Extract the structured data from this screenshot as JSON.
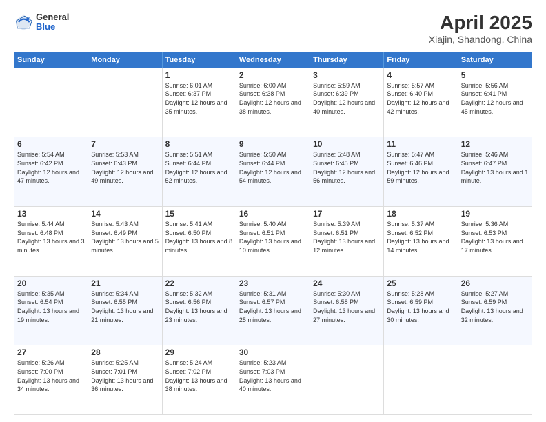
{
  "header": {
    "logo_line1": "General",
    "logo_line2": "Blue",
    "title": "April 2025",
    "subtitle": "Xiajin, Shandong, China"
  },
  "days_of_week": [
    "Sunday",
    "Monday",
    "Tuesday",
    "Wednesday",
    "Thursday",
    "Friday",
    "Saturday"
  ],
  "weeks": [
    [
      {
        "day": "",
        "sunrise": "",
        "sunset": "",
        "daylight": ""
      },
      {
        "day": "",
        "sunrise": "",
        "sunset": "",
        "daylight": ""
      },
      {
        "day": "1",
        "sunrise": "Sunrise: 6:01 AM",
        "sunset": "Sunset: 6:37 PM",
        "daylight": "Daylight: 12 hours and 35 minutes."
      },
      {
        "day": "2",
        "sunrise": "Sunrise: 6:00 AM",
        "sunset": "Sunset: 6:38 PM",
        "daylight": "Daylight: 12 hours and 38 minutes."
      },
      {
        "day": "3",
        "sunrise": "Sunrise: 5:59 AM",
        "sunset": "Sunset: 6:39 PM",
        "daylight": "Daylight: 12 hours and 40 minutes."
      },
      {
        "day": "4",
        "sunrise": "Sunrise: 5:57 AM",
        "sunset": "Sunset: 6:40 PM",
        "daylight": "Daylight: 12 hours and 42 minutes."
      },
      {
        "day": "5",
        "sunrise": "Sunrise: 5:56 AM",
        "sunset": "Sunset: 6:41 PM",
        "daylight": "Daylight: 12 hours and 45 minutes."
      }
    ],
    [
      {
        "day": "6",
        "sunrise": "Sunrise: 5:54 AM",
        "sunset": "Sunset: 6:42 PM",
        "daylight": "Daylight: 12 hours and 47 minutes."
      },
      {
        "day": "7",
        "sunrise": "Sunrise: 5:53 AM",
        "sunset": "Sunset: 6:43 PM",
        "daylight": "Daylight: 12 hours and 49 minutes."
      },
      {
        "day": "8",
        "sunrise": "Sunrise: 5:51 AM",
        "sunset": "Sunset: 6:44 PM",
        "daylight": "Daylight: 12 hours and 52 minutes."
      },
      {
        "day": "9",
        "sunrise": "Sunrise: 5:50 AM",
        "sunset": "Sunset: 6:44 PM",
        "daylight": "Daylight: 12 hours and 54 minutes."
      },
      {
        "day": "10",
        "sunrise": "Sunrise: 5:48 AM",
        "sunset": "Sunset: 6:45 PM",
        "daylight": "Daylight: 12 hours and 56 minutes."
      },
      {
        "day": "11",
        "sunrise": "Sunrise: 5:47 AM",
        "sunset": "Sunset: 6:46 PM",
        "daylight": "Daylight: 12 hours and 59 minutes."
      },
      {
        "day": "12",
        "sunrise": "Sunrise: 5:46 AM",
        "sunset": "Sunset: 6:47 PM",
        "daylight": "Daylight: 13 hours and 1 minute."
      }
    ],
    [
      {
        "day": "13",
        "sunrise": "Sunrise: 5:44 AM",
        "sunset": "Sunset: 6:48 PM",
        "daylight": "Daylight: 13 hours and 3 minutes."
      },
      {
        "day": "14",
        "sunrise": "Sunrise: 5:43 AM",
        "sunset": "Sunset: 6:49 PM",
        "daylight": "Daylight: 13 hours and 5 minutes."
      },
      {
        "day": "15",
        "sunrise": "Sunrise: 5:41 AM",
        "sunset": "Sunset: 6:50 PM",
        "daylight": "Daylight: 13 hours and 8 minutes."
      },
      {
        "day": "16",
        "sunrise": "Sunrise: 5:40 AM",
        "sunset": "Sunset: 6:51 PM",
        "daylight": "Daylight: 13 hours and 10 minutes."
      },
      {
        "day": "17",
        "sunrise": "Sunrise: 5:39 AM",
        "sunset": "Sunset: 6:51 PM",
        "daylight": "Daylight: 13 hours and 12 minutes."
      },
      {
        "day": "18",
        "sunrise": "Sunrise: 5:37 AM",
        "sunset": "Sunset: 6:52 PM",
        "daylight": "Daylight: 13 hours and 14 minutes."
      },
      {
        "day": "19",
        "sunrise": "Sunrise: 5:36 AM",
        "sunset": "Sunset: 6:53 PM",
        "daylight": "Daylight: 13 hours and 17 minutes."
      }
    ],
    [
      {
        "day": "20",
        "sunrise": "Sunrise: 5:35 AM",
        "sunset": "Sunset: 6:54 PM",
        "daylight": "Daylight: 13 hours and 19 minutes."
      },
      {
        "day": "21",
        "sunrise": "Sunrise: 5:34 AM",
        "sunset": "Sunset: 6:55 PM",
        "daylight": "Daylight: 13 hours and 21 minutes."
      },
      {
        "day": "22",
        "sunrise": "Sunrise: 5:32 AM",
        "sunset": "Sunset: 6:56 PM",
        "daylight": "Daylight: 13 hours and 23 minutes."
      },
      {
        "day": "23",
        "sunrise": "Sunrise: 5:31 AM",
        "sunset": "Sunset: 6:57 PM",
        "daylight": "Daylight: 13 hours and 25 minutes."
      },
      {
        "day": "24",
        "sunrise": "Sunrise: 5:30 AM",
        "sunset": "Sunset: 6:58 PM",
        "daylight": "Daylight: 13 hours and 27 minutes."
      },
      {
        "day": "25",
        "sunrise": "Sunrise: 5:28 AM",
        "sunset": "Sunset: 6:59 PM",
        "daylight": "Daylight: 13 hours and 30 minutes."
      },
      {
        "day": "26",
        "sunrise": "Sunrise: 5:27 AM",
        "sunset": "Sunset: 6:59 PM",
        "daylight": "Daylight: 13 hours and 32 minutes."
      }
    ],
    [
      {
        "day": "27",
        "sunrise": "Sunrise: 5:26 AM",
        "sunset": "Sunset: 7:00 PM",
        "daylight": "Daylight: 13 hours and 34 minutes."
      },
      {
        "day": "28",
        "sunrise": "Sunrise: 5:25 AM",
        "sunset": "Sunset: 7:01 PM",
        "daylight": "Daylight: 13 hours and 36 minutes."
      },
      {
        "day": "29",
        "sunrise": "Sunrise: 5:24 AM",
        "sunset": "Sunset: 7:02 PM",
        "daylight": "Daylight: 13 hours and 38 minutes."
      },
      {
        "day": "30",
        "sunrise": "Sunrise: 5:23 AM",
        "sunset": "Sunset: 7:03 PM",
        "daylight": "Daylight: 13 hours and 40 minutes."
      },
      {
        "day": "",
        "sunrise": "",
        "sunset": "",
        "daylight": ""
      },
      {
        "day": "",
        "sunrise": "",
        "sunset": "",
        "daylight": ""
      },
      {
        "day": "",
        "sunrise": "",
        "sunset": "",
        "daylight": ""
      }
    ]
  ]
}
